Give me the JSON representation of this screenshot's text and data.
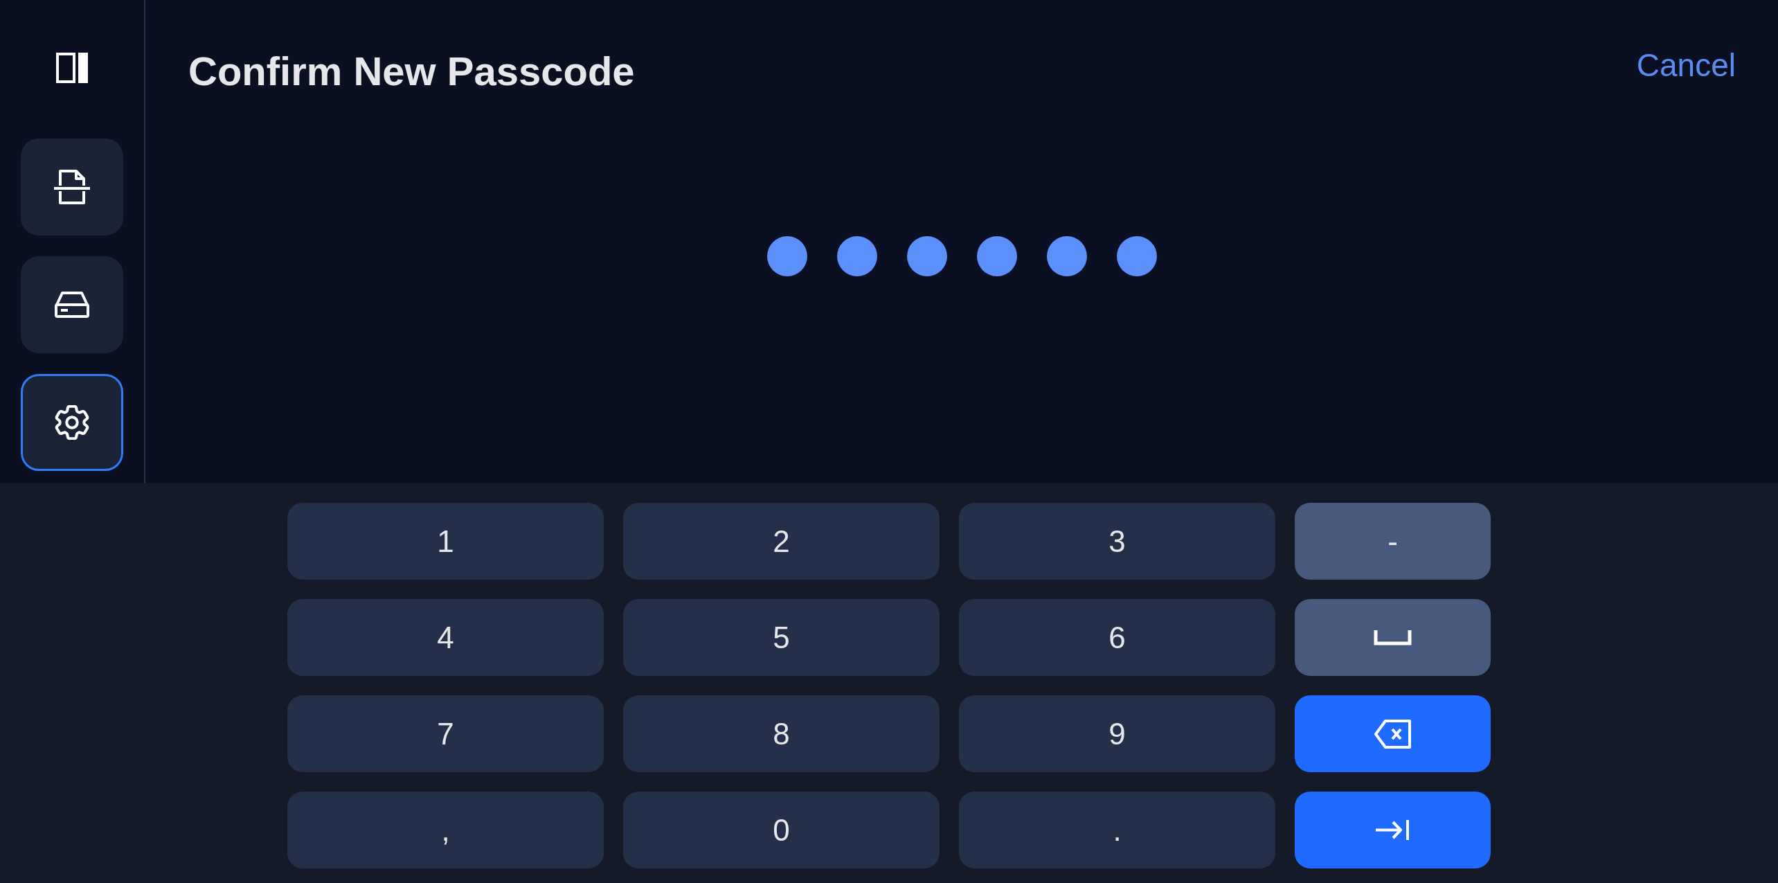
{
  "sidebar": {
    "items": [
      {
        "kind": "scan",
        "selected": false
      },
      {
        "kind": "drive",
        "selected": false
      },
      {
        "kind": "settings",
        "selected": true
      }
    ]
  },
  "header": {
    "title": "Confirm New Passcode",
    "cancel": "Cancel"
  },
  "passcode_dots": [
    {
      "filled": true
    },
    {
      "filled": true
    },
    {
      "filled": true
    },
    {
      "filled": true
    },
    {
      "filled": true
    },
    {
      "filled": true
    }
  ],
  "keypad": {
    "rows": [
      [
        {
          "kind": "char",
          "label": "1"
        },
        {
          "kind": "char",
          "label": "2"
        },
        {
          "kind": "char",
          "label": "3"
        },
        {
          "kind": "symbol",
          "label": "-"
        }
      ],
      [
        {
          "kind": "char",
          "label": "4"
        },
        {
          "kind": "char",
          "label": "5"
        },
        {
          "kind": "char",
          "label": "6"
        },
        {
          "kind": "space"
        }
      ],
      [
        {
          "kind": "char",
          "label": "7"
        },
        {
          "kind": "char",
          "label": "8"
        },
        {
          "kind": "char",
          "label": "9"
        },
        {
          "kind": "backspace"
        }
      ],
      [
        {
          "kind": "char",
          "label": ","
        },
        {
          "kind": "char",
          "label": "0"
        },
        {
          "kind": "char",
          "label": "."
        },
        {
          "kind": "tab"
        }
      ]
    ]
  }
}
